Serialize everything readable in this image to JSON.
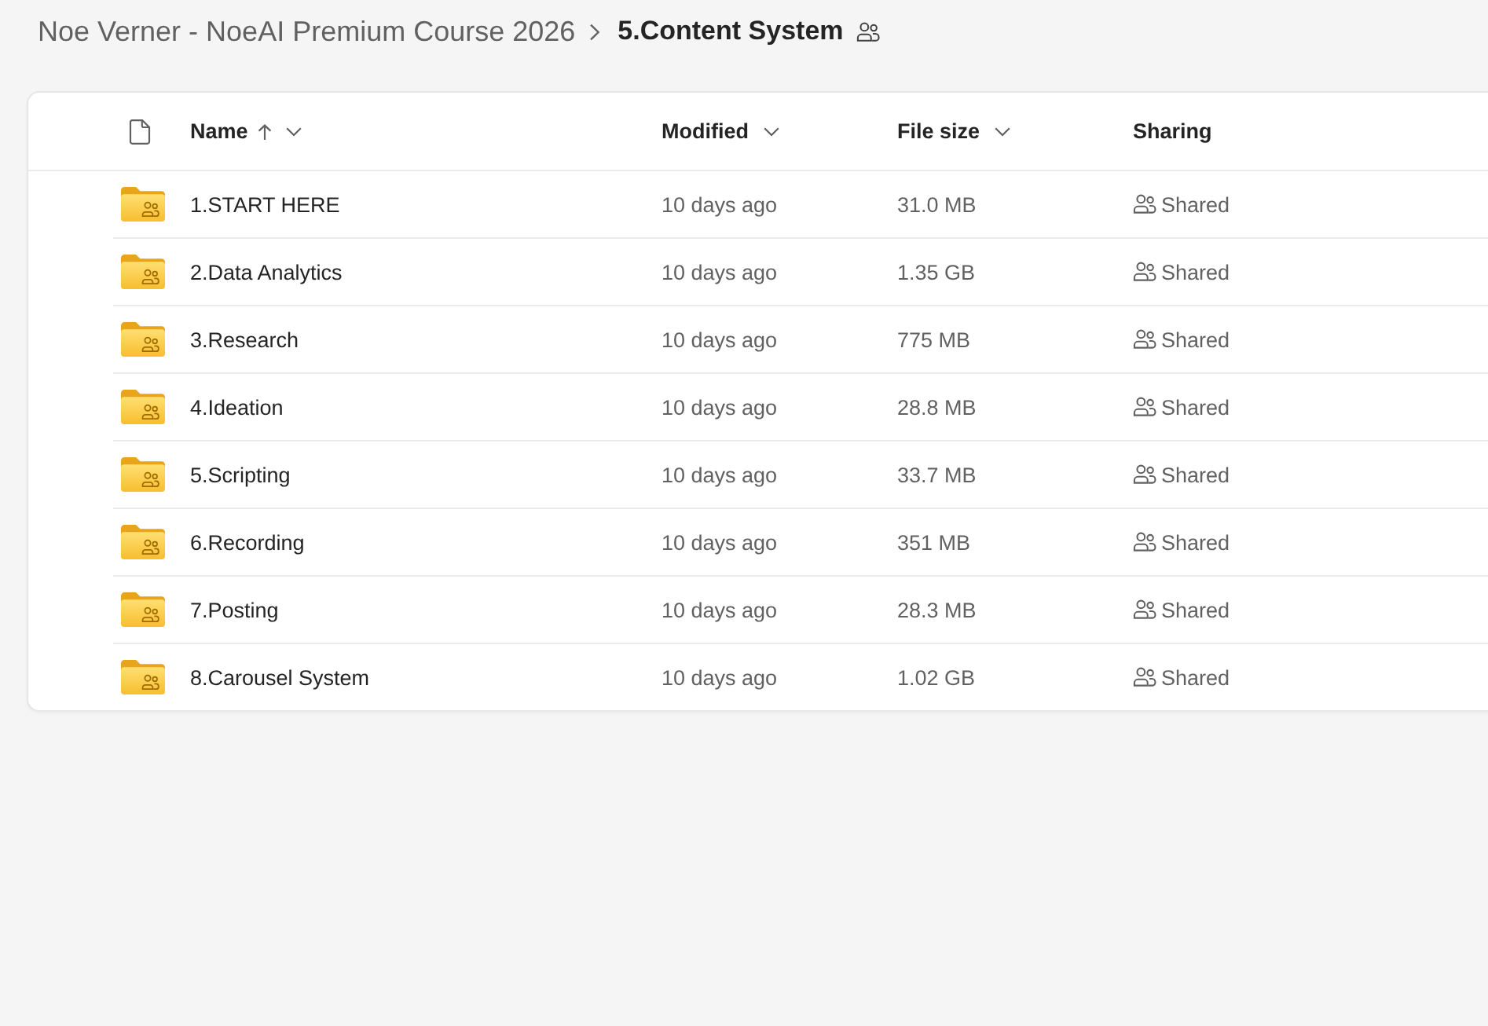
{
  "breadcrumb": [
    {
      "label": "Noe Verner - NoeAI Premium Course 2026",
      "current": false
    },
    {
      "label": "5.Content System",
      "current": true
    }
  ],
  "columns": [
    {
      "label": "Name",
      "sorted_ascending": true,
      "has_menu": true
    },
    {
      "label": "Modified",
      "sorted_ascending": false,
      "has_menu": true
    },
    {
      "label": "File size",
      "sorted_ascending": false,
      "has_menu": true
    },
    {
      "label": "Sharing",
      "sorted_ascending": false,
      "has_menu": false
    }
  ],
  "rows": [
    {
      "name": "1.START HERE",
      "modified": "10 days ago",
      "size": "31.0 MB",
      "sharing": "Shared"
    },
    {
      "name": "2.Data Analytics",
      "modified": "10 days ago",
      "size": "1.35 GB",
      "sharing": "Shared"
    },
    {
      "name": "3.Research",
      "modified": "10 days ago",
      "size": "775 MB",
      "sharing": "Shared"
    },
    {
      "name": "4.Ideation",
      "modified": "10 days ago",
      "size": "28.8 MB",
      "sharing": "Shared"
    },
    {
      "name": "5.Scripting",
      "modified": "10 days ago",
      "size": "33.7 MB",
      "sharing": "Shared"
    },
    {
      "name": "6.Recording",
      "modified": "10 days ago",
      "size": "351 MB",
      "sharing": "Shared"
    },
    {
      "name": "7.Posting",
      "modified": "10 days ago",
      "size": "28.3 MB",
      "sharing": "Shared"
    },
    {
      "name": "8.Carousel System",
      "modified": "10 days ago",
      "size": "1.02 GB",
      "sharing": "Shared"
    }
  ]
}
